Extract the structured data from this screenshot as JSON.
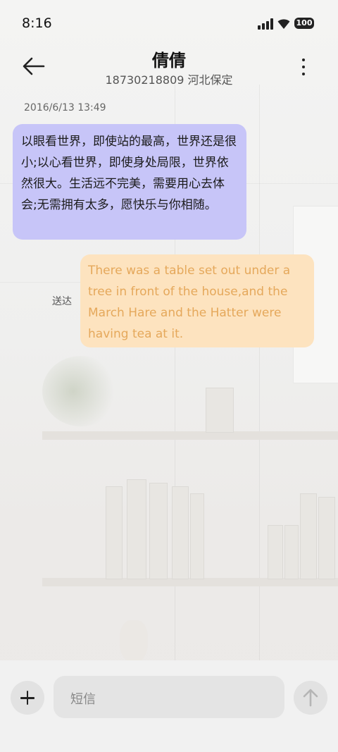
{
  "status_bar": {
    "time": "8:16",
    "battery": "100"
  },
  "header": {
    "contact_name": "倩倩",
    "contact_detail": "18730218809 河北保定"
  },
  "conversation": {
    "timestamp": "2016/6/13 13:49",
    "messages": [
      {
        "direction": "incoming",
        "text": "以眼看世界，即使站的最高，世界还是很小;以心看世界，即使身处局限，世界依然很大。生活远不完美，需要用心去体会;无需拥有太多，愿快乐与你相随。"
      },
      {
        "direction": "outgoing",
        "text": "There was a table set out under a tree in front of the house,and the March Hare and the Hatter were having tea at it.",
        "status": "送达"
      }
    ]
  },
  "composer": {
    "placeholder": "短信"
  },
  "colors": {
    "incoming_bubble": "#c7c5f8",
    "outgoing_bubble": "#fde3bf",
    "outgoing_text": "#e5a85b"
  },
  "icons": {
    "back": "arrow-left-icon",
    "more": "more-vertical-icon",
    "add": "plus-icon",
    "send": "arrow-up-icon"
  }
}
